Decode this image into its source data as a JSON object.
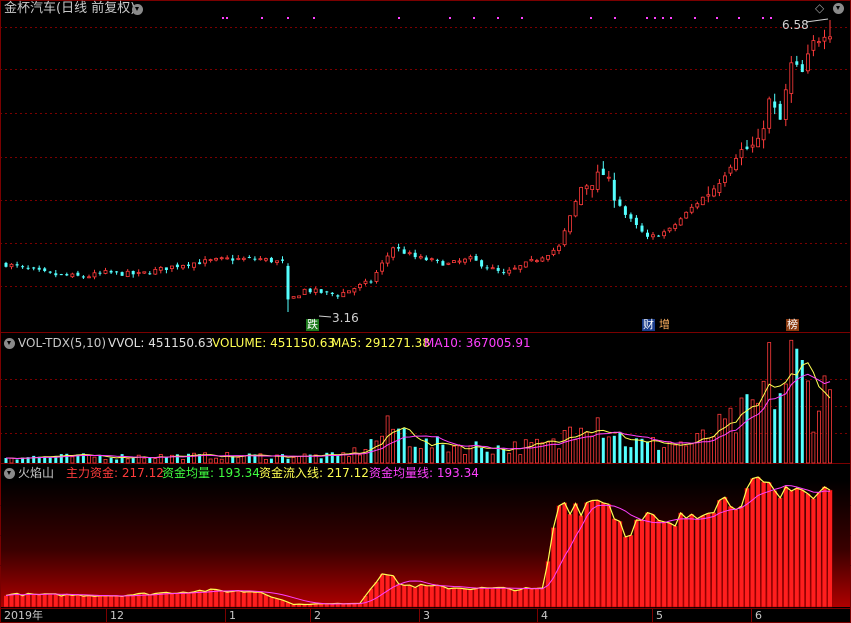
{
  "main_panel": {
    "title": "金杯汽车(日线 前复权)",
    "high_label": "6.58",
    "low_label": "3.16",
    "event_tags": [
      "跌",
      "财",
      "增",
      "榜"
    ],
    "corner_icons": [
      "diamond-icon",
      "chevron-down-icon"
    ]
  },
  "volume_panel": {
    "name": "VOL-TDX(5,10)",
    "vvol": "VVOL: 451150.63",
    "volume": "VOLUME: 451150.63",
    "ma5": "MA5: 291271.38",
    "ma10": "MA10: 367005.91"
  },
  "fire_panel": {
    "name": "火焰山",
    "main_funds": "主力资金: 217.12",
    "avg_funds": "资金均量: 193.34",
    "inflow_line": "资金流入线: 217.12",
    "avg_line": "资金均量线: 193.34"
  },
  "time_axis": [
    "2019年",
    "12",
    "1",
    "2",
    "3",
    "4",
    "5",
    "6"
  ],
  "colors": {
    "up": "#ff3b3b",
    "down": "#54ffff",
    "ma5": "#ffff52",
    "ma10": "#ff40ff",
    "grid": "#7a0000",
    "title": "#c8c8c8"
  },
  "chart_data": {
    "type": "candlestick",
    "price_high": 6.58,
    "price_low": 3.16,
    "close_curve": [
      [
        0,
        3.72
      ],
      [
        8,
        3.6
      ],
      [
        14,
        3.57
      ],
      [
        18,
        3.62
      ],
      [
        24,
        3.6
      ],
      [
        32,
        3.72
      ],
      [
        40,
        3.78
      ],
      [
        46,
        3.78
      ],
      [
        50,
        3.74
      ],
      [
        51,
        3.28
      ],
      [
        54,
        3.42
      ],
      [
        60,
        3.36
      ],
      [
        66,
        3.52
      ],
      [
        70,
        3.92
      ],
      [
        74,
        3.8
      ],
      [
        80,
        3.72
      ],
      [
        84,
        3.78
      ],
      [
        90,
        3.6
      ],
      [
        96,
        3.78
      ],
      [
        100,
        3.92
      ],
      [
        104,
        4.62
      ],
      [
        108,
        4.78
      ],
      [
        112,
        4.3
      ],
      [
        116,
        4.02
      ],
      [
        120,
        4.12
      ],
      [
        124,
        4.38
      ],
      [
        128,
        4.62
      ],
      [
        132,
        5.02
      ],
      [
        136,
        5.12
      ],
      [
        138,
        5.62
      ],
      [
        140,
        5.4
      ],
      [
        142,
        6.05
      ],
      [
        144,
        5.95
      ],
      [
        146,
        6.3
      ],
      [
        148,
        6.45
      ]
    ],
    "volume_curve": [
      [
        0,
        0.06
      ],
      [
        40,
        0.07
      ],
      [
        60,
        0.07
      ],
      [
        64,
        0.12
      ],
      [
        70,
        0.35
      ],
      [
        76,
        0.18
      ],
      [
        90,
        0.15
      ],
      [
        100,
        0.18
      ],
      [
        104,
        0.55
      ],
      [
        108,
        0.4
      ],
      [
        112,
        0.22
      ],
      [
        116,
        0.18
      ],
      [
        120,
        0.2
      ],
      [
        124,
        0.18
      ],
      [
        128,
        0.3
      ],
      [
        132,
        0.4
      ],
      [
        136,
        0.55
      ],
      [
        138,
        0.85
      ],
      [
        140,
        0.7
      ],
      [
        142,
        0.95
      ],
      [
        144,
        0.85
      ],
      [
        146,
        0.6
      ],
      [
        148,
        0.68
      ]
    ],
    "funds_curve": [
      [
        0,
        0.1
      ],
      [
        20,
        0.09
      ],
      [
        36,
        0.13
      ],
      [
        46,
        0.12
      ],
      [
        52,
        0.02
      ],
      [
        64,
        0.03
      ],
      [
        68,
        0.28
      ],
      [
        72,
        0.17
      ],
      [
        82,
        0.15
      ],
      [
        94,
        0.14
      ],
      [
        97,
        0.14
      ],
      [
        100,
        0.82
      ],
      [
        104,
        0.8
      ],
      [
        108,
        0.88
      ],
      [
        112,
        0.6
      ],
      [
        116,
        0.7
      ],
      [
        120,
        0.62
      ],
      [
        124,
        0.75
      ],
      [
        128,
        0.82
      ],
      [
        132,
        0.85
      ],
      [
        134,
        0.9
      ],
      [
        136,
        0.95
      ],
      [
        140,
        0.85
      ],
      [
        142,
        1.0
      ],
      [
        146,
        0.85
      ],
      [
        148,
        0.92
      ]
    ]
  }
}
